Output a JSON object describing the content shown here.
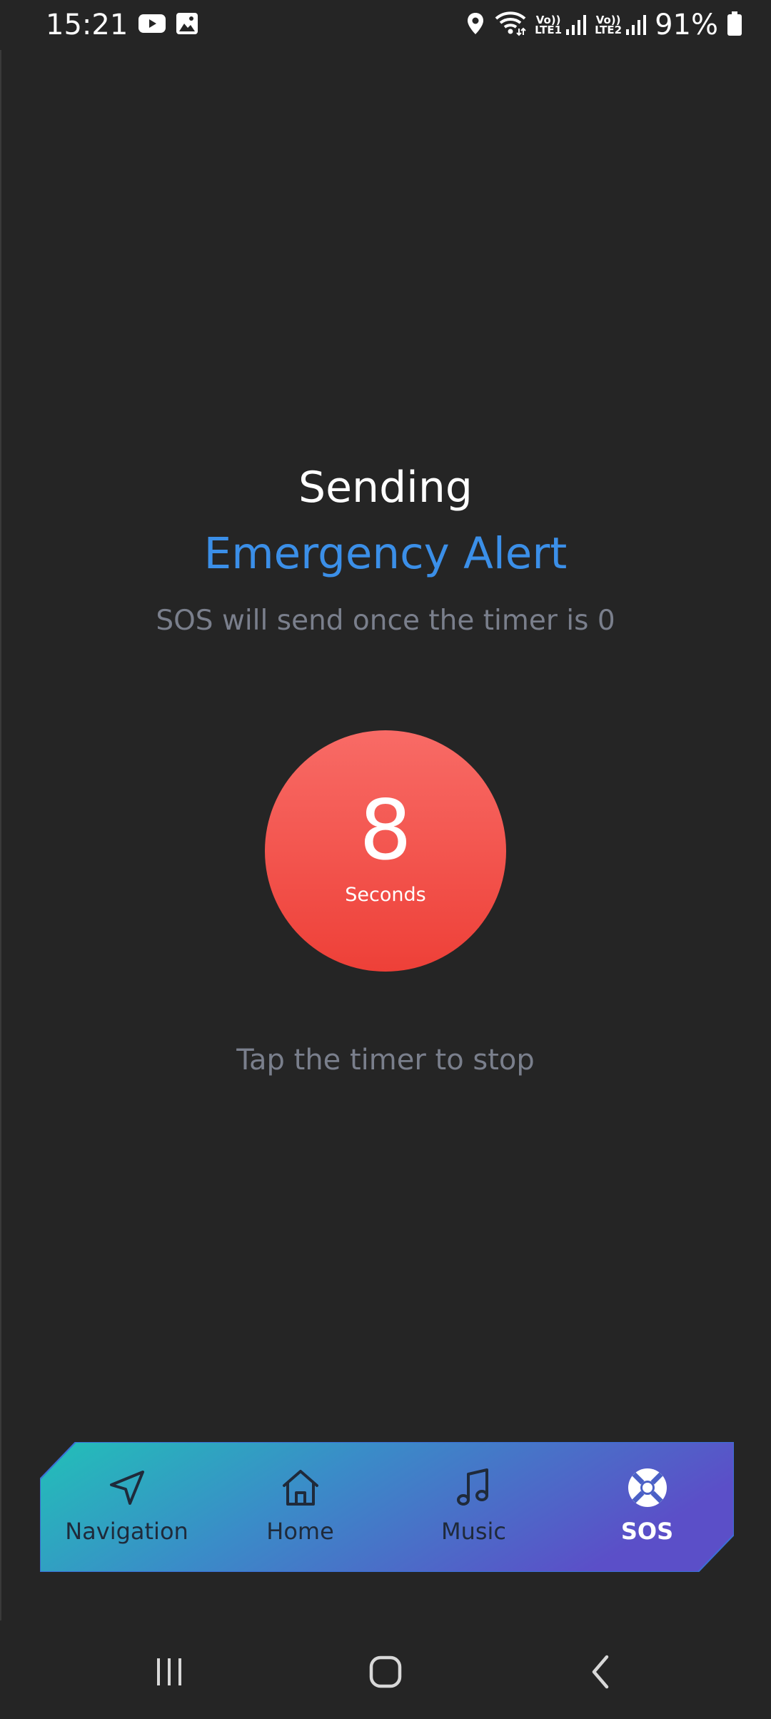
{
  "status_bar": {
    "time": "15:21",
    "icons_left": [
      "youtube-icon",
      "gallery-icon"
    ],
    "icons_right": [
      "location-icon",
      "wifi-icon",
      "signal-lte1-icon",
      "signal-lte2-icon",
      "battery-icon"
    ],
    "lte1": "Vo)) LTE1",
    "lte2": "Vo)) LTE2",
    "battery": "91%"
  },
  "main": {
    "title": "Sending",
    "subtitle": "Emergency Alert",
    "description": "SOS will send once the timer is 0",
    "timer": {
      "value": "8",
      "unit": "Seconds"
    },
    "hint": "Tap the timer to stop"
  },
  "bottom_nav": {
    "items": [
      {
        "label": "Navigation",
        "icon": "navigation-arrow-icon",
        "active": false
      },
      {
        "label": "Home",
        "icon": "home-icon",
        "active": false
      },
      {
        "label": "Music",
        "icon": "music-note-icon",
        "active": false
      },
      {
        "label": "SOS",
        "icon": "lifebuoy-icon",
        "active": true
      }
    ],
    "gradient_start": "#22c0b8",
    "gradient_end": "#5b4fc8"
  },
  "colors": {
    "background": "#252525",
    "accent_blue": "#3b8fe8",
    "timer_red": "#f0463e",
    "muted_text": "#7a7f8c"
  },
  "system_nav": {
    "buttons": [
      "recent-apps-icon",
      "home-button-icon",
      "back-icon"
    ]
  }
}
